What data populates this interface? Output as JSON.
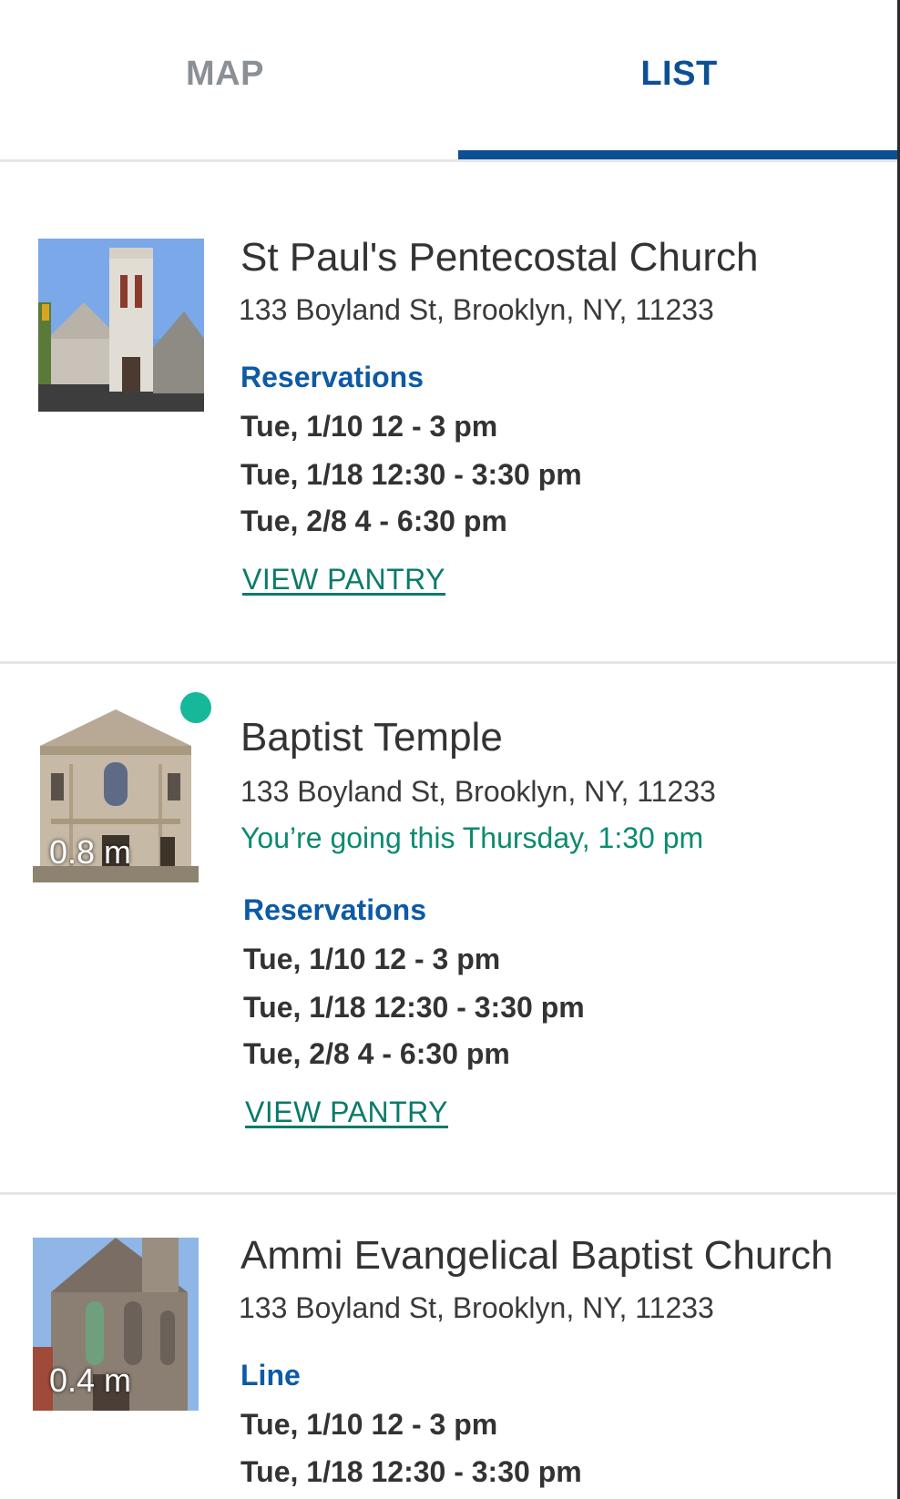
{
  "tabs": [
    {
      "label": "MAP",
      "active": false
    },
    {
      "label": "LIST",
      "active": true
    }
  ],
  "colors": {
    "accent_blue": "#0d4f93",
    "link_green": "#0b7a6a",
    "going_green": "#0b8a70",
    "status_dot": "#16b89a"
  },
  "pantries": [
    {
      "name": "St Paul's Pentecostal Church",
      "address": "133 Boyland St, Brooklyn, NY, 11233",
      "distance": "",
      "going_text": "",
      "section_label": "Reservations",
      "slots": [
        "Tue, 1/10 12 - 3 pm",
        "Tue, 1/18 12:30 - 3:30 pm",
        "Tue, 2/8 4 - 6:30 pm"
      ],
      "link_label": "VIEW PANTRY",
      "image_icon": "church-photo"
    },
    {
      "name": "Baptist Temple",
      "address": "133 Boyland St, Brooklyn, NY, 11233",
      "distance": "0.8 m",
      "going_text": "You’re going this Thursday, 1:30 pm",
      "section_label": "Reservations",
      "slots": [
        "Tue, 1/10 12 - 3 pm",
        "Tue, 1/18 12:30 - 3:30 pm",
        "Tue, 2/8 4 - 6:30 pm"
      ],
      "link_label": "VIEW PANTRY",
      "image_icon": "temple-photo"
    },
    {
      "name": "Ammi Evangelical Baptist Church",
      "address": "133 Boyland St, Brooklyn, NY, 11233",
      "distance": "0.4 m",
      "going_text": "",
      "section_label": "Line",
      "slots": [
        "Tue, 1/10 12 - 3 pm",
        "Tue, 1/18 12:30 - 3:30 pm"
      ],
      "link_label": "",
      "image_icon": "church-photo"
    }
  ]
}
